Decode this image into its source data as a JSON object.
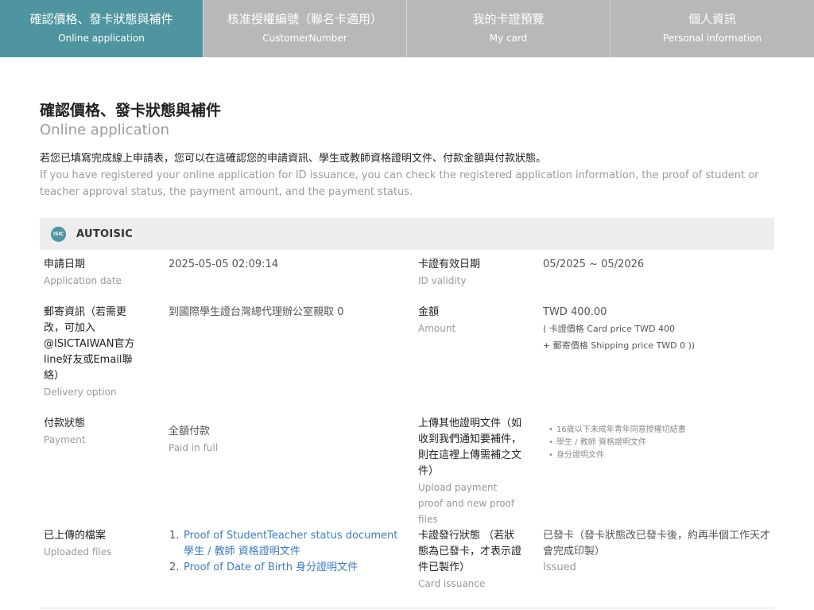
{
  "tabs": [
    {
      "zh": "確認價格、發卡狀態與補件",
      "en": "Online application",
      "active": true
    },
    {
      "zh": "核准授權編號（聯名卡適用）",
      "en": "CustomerNumber",
      "active": false
    },
    {
      "zh": "我的卡證預覽",
      "en": "My card",
      "active": false
    },
    {
      "zh": "個人資訊",
      "en": "Personal information",
      "active": false
    }
  ],
  "page": {
    "title_zh": "確認價格、發卡狀態與補件",
    "title_en": "Online application",
    "intro_zh": "若您已填寫完成線上申請表，您可以在這確認您的申請資訊、學生或教師資格證明文件、付款金額與付款狀態。",
    "intro_en": "If you have registered your online application for ID issuance, you can check the registered application information, the proof of student or teacher approval status, the payment amount, and the payment status."
  },
  "card": {
    "icon_text": "ISIC",
    "name": "AUTOISIC"
  },
  "fields": {
    "application_date": {
      "label_zh": "申請日期",
      "label_en": "Application date",
      "value": "2025-05-05 02:09:14"
    },
    "validity": {
      "label_zh": "卡證有效日期",
      "label_en": "ID validity",
      "value": "05/2025 ~ 05/2026"
    },
    "delivery": {
      "label_zh": "郵寄資訊（若需更改，可加入@ISICTAIWAN官方line好友或Email聯絡）",
      "label_en": "Delivery option",
      "value": "到國際學生證台灣總代理辦公室親取 0"
    },
    "amount": {
      "label_zh": "金額",
      "label_en": "Amount",
      "value": "TWD 400.00",
      "line1": "( 卡證價格 Card price TWD 400",
      "line2": "+ 郵寄價格 Shipping price TWD 0 ))"
    },
    "payment": {
      "label_zh": "付款狀態",
      "label_en": "Payment",
      "value": "全額付款",
      "value_en": "Paid in full"
    },
    "upload": {
      "label_zh": "上傳其他證明文件（如收到我們通知要補件，則在這裡上傳需補之文件）",
      "label_en": "Upload payment proof and new proof files",
      "items": [
        "16歲以下未成年青年同意授權切結書",
        "學生 / 教師 資格證明文件",
        "身分證明文件"
      ]
    },
    "uploaded_files": {
      "label_zh": "已上傳的檔案",
      "label_en": "Uploaded files",
      "items": [
        {
          "num": "1.",
          "text": "Proof of StudentTeacher status document 學生 / 教師 資格證明文件"
        },
        {
          "num": "2.",
          "text": "Proof of Date of Birth 身分證明文件"
        }
      ]
    },
    "issuance": {
      "label_zh": "卡證發行狀態 （若狀態為已發卡，才表示證件已製作）",
      "label_en": "Card issuance",
      "value": "已發卡（發卡狀態改已發卡後，約再半個工作天才會完成印製）",
      "value_en": "Issued"
    }
  },
  "colors": {
    "accent": "#4e95a0",
    "tab_inactive": "#b8b8b8",
    "link": "#3b7dc4",
    "header_bg": "#ededed"
  }
}
